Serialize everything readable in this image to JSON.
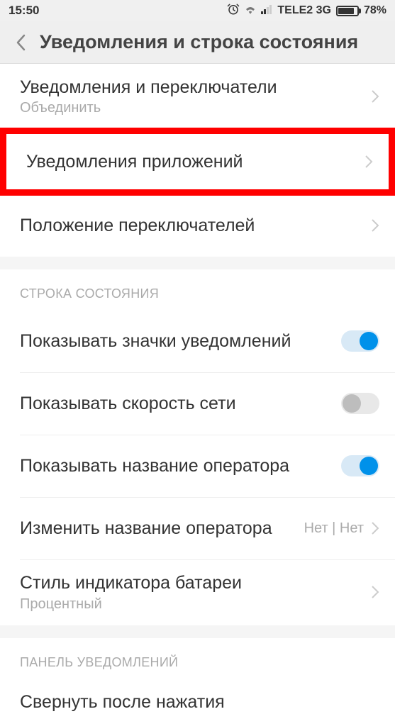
{
  "status_bar": {
    "time": "15:50",
    "carrier": "TELE2 3G",
    "battery_percent": "78%"
  },
  "header": {
    "title": "Уведомления и строка состояния"
  },
  "group1": {
    "item1": {
      "title": "Уведомления и переключатели",
      "sub": "Объединить"
    },
    "item2": {
      "title": "Уведомления приложений"
    },
    "item3": {
      "title": "Положение переключателей"
    }
  },
  "section_status_bar": {
    "header": "СТРОКА СОСТОЯНИЯ",
    "item1": {
      "title": "Показывать значки уведомлений"
    },
    "item2": {
      "title": "Показывать скорость сети"
    },
    "item3": {
      "title": "Показывать название оператора"
    },
    "item4": {
      "title": "Изменить название оператора",
      "value": "Нет | Нет"
    },
    "item5": {
      "title": "Стиль индикатора батареи",
      "sub": "Процентный"
    }
  },
  "section_notifications": {
    "header": "ПАНЕЛЬ УВЕДОМЛЕНИЙ",
    "item1": {
      "title": "Свернуть после нажатия"
    }
  }
}
